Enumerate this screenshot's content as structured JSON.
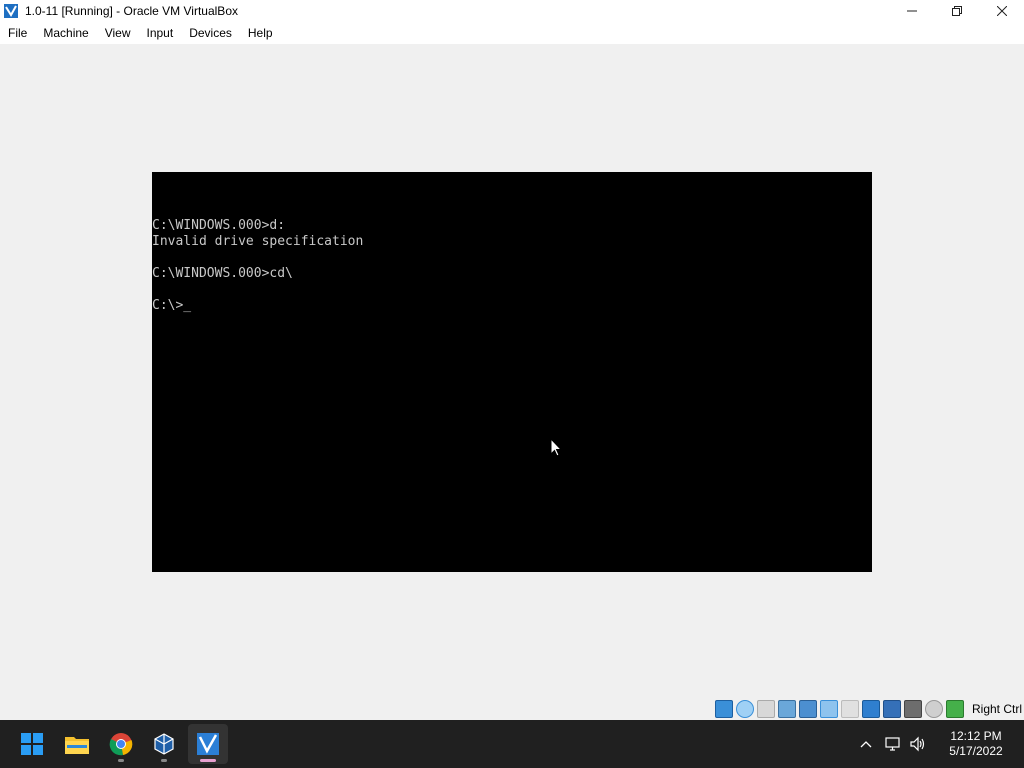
{
  "window": {
    "title": "1.0-11 [Running] - Oracle VM VirtualBox",
    "controls": [
      "minimize-icon",
      "restore-icon",
      "close-icon"
    ]
  },
  "menu": {
    "file": "File",
    "machine": "Machine",
    "view": "View",
    "input": "Input",
    "devices": "Devices",
    "help": "Help"
  },
  "console": {
    "lines": [
      "C:\\WINDOWS.000>d:",
      "Invalid drive specification",
      "",
      "C:\\WINDOWS.000>cd\\",
      "",
      "C:\\>_"
    ]
  },
  "statusbar": {
    "icons": [
      "hard-disk-icon",
      "optical-drive-icon",
      "floppy-icon",
      "audio-icon",
      "network-icon",
      "usb-icon",
      "shared-folders-icon",
      "display-icon",
      "recording-icon",
      "virtualization-icon",
      "mouse-integration-icon",
      "keyboard-icon"
    ],
    "host_key": "Right Ctrl"
  },
  "taskbar": {
    "apps": [
      "start-icon",
      "file-explorer-icon",
      "chrome-icon",
      "virtualbox-manager-icon",
      "virtualbox-vm-icon"
    ],
    "tray": [
      "chevron-up-icon",
      "network-icon",
      "volume-icon"
    ],
    "time": "12:12 PM",
    "date": "5/17/2022"
  }
}
